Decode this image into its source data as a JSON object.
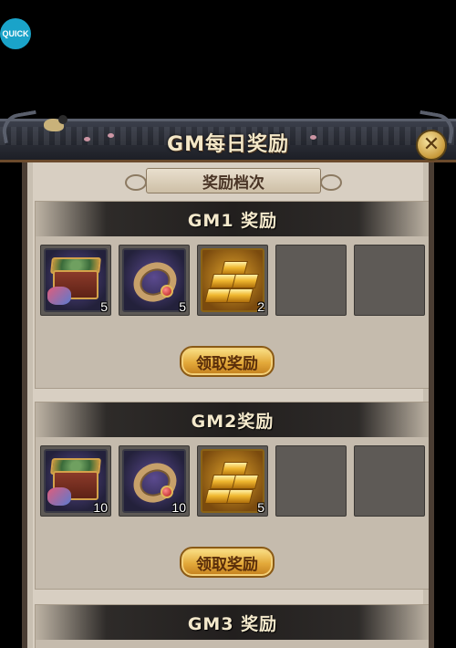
{
  "quick_button": {
    "label": "QUICK"
  },
  "window": {
    "title": "GM每日奖励",
    "subtitle": "奖励档次"
  },
  "tiers": [
    {
      "title": "GM1 奖励",
      "items": [
        {
          "icon": "treasure-chest-icon",
          "qty": "5"
        },
        {
          "icon": "ring-icon",
          "qty": "5"
        },
        {
          "icon": "gold-bars-icon",
          "qty": "2"
        }
      ],
      "claim_label": "领取奖励"
    },
    {
      "title": "GM2奖励",
      "items": [
        {
          "icon": "treasure-chest-icon",
          "qty": "10"
        },
        {
          "icon": "ring-icon",
          "qty": "10"
        },
        {
          "icon": "gold-bars-icon",
          "qty": "5"
        }
      ],
      "claim_label": "领取奖励"
    },
    {
      "title": "GM3 奖励"
    }
  ],
  "colors": {
    "accent_gold": "#e3a93a",
    "quick_blue": "#1aa3c9",
    "panel_bg": "#d8cfc2"
  }
}
